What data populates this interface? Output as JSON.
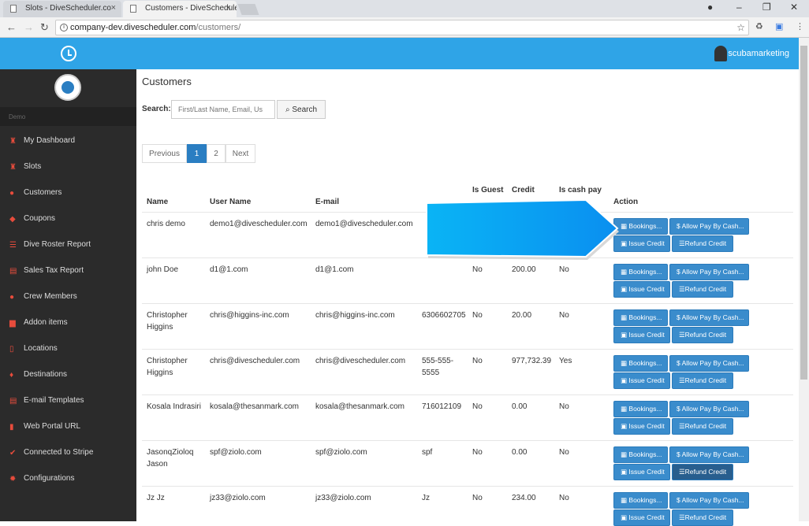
{
  "browser": {
    "tabs": [
      {
        "label": "Slots - DiveScheduler.co"
      },
      {
        "label": "Customers - DiveSchedule"
      }
    ],
    "url_host": "company-dev.divescheduler.com",
    "url_path": "/customers/"
  },
  "header": {
    "username": "scubamarketing"
  },
  "sidebar": {
    "section": "Demo",
    "items": [
      {
        "label": "My Dashboard"
      },
      {
        "label": "Slots"
      },
      {
        "label": "Customers"
      },
      {
        "label": "Coupons"
      },
      {
        "label": "Dive Roster Report"
      },
      {
        "label": "Sales Tax Report"
      },
      {
        "label": "Crew Members"
      },
      {
        "label": "Addon items"
      },
      {
        "label": "Locations"
      },
      {
        "label": "Destinations"
      },
      {
        "label": "E-mail Templates"
      },
      {
        "label": "Web Portal URL"
      },
      {
        "label": "Connected to Stripe"
      },
      {
        "label": "Configurations"
      }
    ]
  },
  "main": {
    "title": "Customers",
    "search_label": "Search:",
    "search_placeholder": "First/Last Name, Email, Us",
    "search_button": "Search",
    "pager": {
      "previous": "Previous",
      "p1": "1",
      "p2": "2",
      "next": "Next"
    },
    "headers": {
      "name": "Name",
      "username": "User Name",
      "email": "E-mail",
      "guest": "Is Guest",
      "credit": "Credit",
      "cash": "Is cash pay",
      "action": "Action"
    },
    "actions": {
      "bookings": "Bookings...",
      "allow": "Allow Pay By Cash...",
      "issue": "Issue Credit",
      "refund": "Refund Credit"
    },
    "rows": [
      {
        "name": "chris demo",
        "username": "demo1@divescheduler.com",
        "email": "demo1@divescheduler.com",
        "phone": "",
        "guest": "",
        "credit": "",
        "cash": ""
      },
      {
        "name": "john Doe",
        "username": "d1@1.com",
        "email": "d1@1.com",
        "phone": "",
        "guest": "No",
        "credit": "200.00",
        "cash": "No"
      },
      {
        "name": "Christopher Higgins",
        "username": "chris@higgins-inc.com",
        "email": "chris@higgins-inc.com",
        "phone": "6306602705",
        "guest": "No",
        "credit": "20.00",
        "cash": "No"
      },
      {
        "name": "Christopher Higgins",
        "username": "chris@divescheduler.com",
        "email": "chris@divescheduler.com",
        "phone": "555-555-5555",
        "guest": "No",
        "credit": "977,732.39",
        "cash": "Yes"
      },
      {
        "name": "Kosala Indrasiri",
        "username": "kosala@thesanmark.com",
        "email": "kosala@thesanmark.com",
        "phone": "716012109",
        "guest": "No",
        "credit": "0.00",
        "cash": "No"
      },
      {
        "name": "JasonqZioloq Jason",
        "username": "spf@ziolo.com",
        "email": "spf@ziolo.com",
        "phone": "spf",
        "guest": "No",
        "credit": "0.00",
        "cash": "No"
      },
      {
        "name": "Jz Jz",
        "username": "jz33@ziolo.com",
        "email": "jz33@ziolo.com",
        "phone": "Jz",
        "guest": "No",
        "credit": "234.00",
        "cash": "No"
      }
    ]
  }
}
